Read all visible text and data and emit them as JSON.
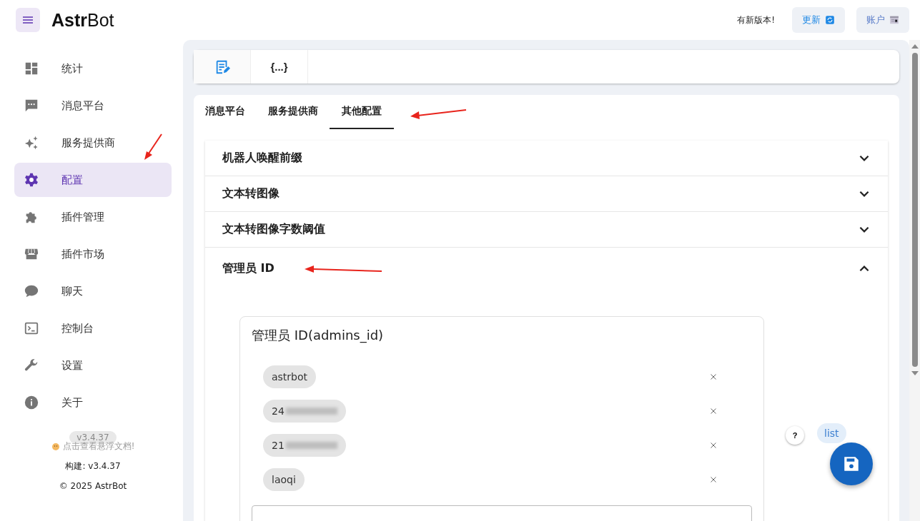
{
  "header": {
    "logo": {
      "bold": "Astr",
      "rest": "Bot"
    },
    "notice": "有新版本!",
    "buttons": [
      {
        "label": "更新",
        "kind": "update"
      },
      {
        "label": "账户",
        "kind": "account"
      }
    ]
  },
  "sidebar": {
    "items": [
      {
        "label": "统计",
        "kind": "dashboard",
        "selected": false
      },
      {
        "label": "消息平台",
        "kind": "message",
        "selected": false
      },
      {
        "label": "服务提供商",
        "kind": "sparkle",
        "selected": false
      },
      {
        "label": "配置",
        "kind": "gear",
        "selected": true
      },
      {
        "label": "插件管理",
        "kind": "puzzle",
        "selected": false
      },
      {
        "label": "插件市场",
        "kind": "store",
        "selected": false
      },
      {
        "label": "聊天",
        "kind": "chat",
        "selected": false
      },
      {
        "label": "控制台",
        "kind": "console",
        "selected": false
      },
      {
        "label": "设置",
        "kind": "wrench",
        "selected": false
      },
      {
        "label": "关于",
        "kind": "info",
        "selected": false
      }
    ],
    "version_badge": "v3.4.37",
    "docs_link": "点击查看悬浮文档!",
    "build": "构建: v3.4.37",
    "copyright": "© 2025 AstrBot"
  },
  "toolbar": {
    "buttons": [
      {
        "kind": "visual",
        "selected": true
      },
      {
        "kind": "code",
        "label": "{...}",
        "selected": false
      }
    ]
  },
  "tabs": [
    {
      "label": "消息平台",
      "selected": false
    },
    {
      "label": "服务提供商",
      "selected": false
    },
    {
      "label": "其他配置",
      "selected": true
    }
  ],
  "panels": [
    {
      "title": "机器人唤醒前缀",
      "expanded": false
    },
    {
      "title": "文本转图像",
      "expanded": false
    },
    {
      "title": "文本转图像字数阈值",
      "expanded": false
    },
    {
      "title": "管理员 ID",
      "expanded": true
    }
  ],
  "list_editor": {
    "title": "管理员 ID(admins_id)",
    "chips": [
      {
        "label": "astrbot",
        "redacted": false
      },
      {
        "label": "24",
        "redacted": true
      },
      {
        "label": "21",
        "redacted": true
      },
      {
        "label": "laoqi",
        "redacted": false
      }
    ],
    "help": "?",
    "type_chip": "list"
  }
}
